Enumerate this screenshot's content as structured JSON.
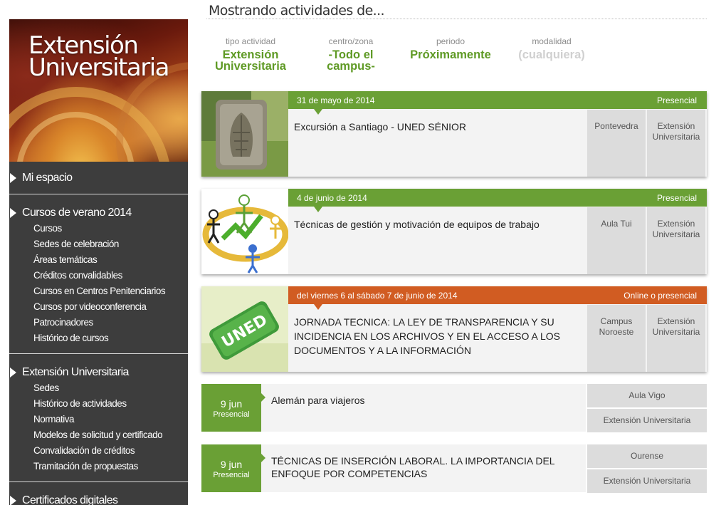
{
  "sidebar": {
    "banner_line1": "Extensión",
    "banner_line2": "Universitaria",
    "mi_espacio": "Mi espacio",
    "cursos_verano": {
      "title": "Cursos de verano 2014",
      "items": [
        "Cursos",
        "Sedes de celebración",
        "Áreas temáticas",
        "Créditos convalidables",
        "Cursos en Centros Penitenciarios",
        "Cursos por videoconferencia",
        "Patrocinadores",
        "Histórico de cursos"
      ]
    },
    "extension": {
      "title": "Extensión Universitaria",
      "items": [
        "Sedes",
        "Histórico de actividades",
        "Normativa",
        "Modelos de solicitud y certificado",
        "Convalidación de créditos",
        "Tramitación de propuestas"
      ]
    },
    "certificados": "Certificados digitales"
  },
  "header": {
    "showing": "Mostrando actividades de...",
    "filters": [
      {
        "label": "tipo actividad",
        "value_line1": "Extensión",
        "value_line2": "Universitaria"
      },
      {
        "label": "centro/zona",
        "value_line1": "-Todo el",
        "value_line2": "campus-"
      },
      {
        "label": "periodo",
        "value_line1": "Próximamente",
        "value_line2": ""
      },
      {
        "label": "modalidad",
        "value_line1": "(cualquiera)",
        "value_line2": ""
      }
    ]
  },
  "cards": [
    {
      "date": "31 de mayo de 2014",
      "mode": "Presencial",
      "title": "Excursión a Santiago - UNED SÉNIOR",
      "place": "Pontevedra",
      "type_line1": "Extensión",
      "type_line2": "Universitaria"
    },
    {
      "date": "4 de junio de 2014",
      "mode": "Presencial",
      "title": "Técnicas de gestión y motivación de equipos de trabajo",
      "place": "Aula Tui",
      "type_line1": "Extensión",
      "type_line2": "Universitaria"
    },
    {
      "date": "del viernes 6 al sábado 7 de junio de 2014",
      "mode": "Online o presencial",
      "title_line1": "JORNADA TECNICA: LA LEY DE TRANSPARENCIA Y SU",
      "title_line2": "INCIDENCIA EN LOS ARCHIVOS Y EN EL ACCESO A LOS",
      "title_line3": "DOCUMENTOS Y A LA INFORMACIÓN",
      "place_line1": "Campus",
      "place_line2": "Noroeste",
      "type_line1": "Extensión",
      "type_line2": "Universitaria",
      "logo_text": "UNED"
    }
  ],
  "items": [
    {
      "day": "9 jun",
      "mode": "Presencial",
      "title": "Alemán para viajeros",
      "place": "Aula Vigo",
      "type": "Extensión Universitaria"
    },
    {
      "day": "9 jun",
      "mode": "Presencial",
      "title_line1": "TÉCNICAS DE INSERCIÓN LABORAL. LA IMPORTANCIA DEL",
      "title_line2": "ENFOQUE POR COMPETENCIAS",
      "place": "Ourense",
      "type": "Extensión Universitaria"
    }
  ],
  "colors": {
    "green": "#6aa035",
    "orange": "#d15c22",
    "sidebar": "#3d3d3d"
  }
}
